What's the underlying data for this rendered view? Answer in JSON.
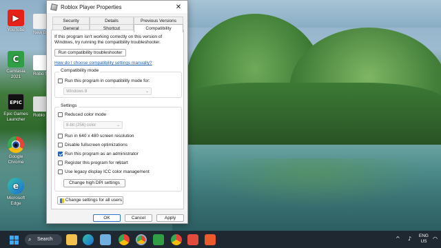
{
  "desktop": {
    "icons": [
      {
        "label": "YouTube",
        "color": "#e62117",
        "glyph": "▶"
      },
      {
        "label": "Camtasia 2021",
        "color": "#2f9e44",
        "glyph": "C"
      },
      {
        "label": "Epic Games Launcher",
        "color": "#111111",
        "glyph": "EPIC"
      },
      {
        "label": "Google Chrome",
        "color": "#e8eaed",
        "glyph": "◉"
      },
      {
        "label": "Microsoft Edge",
        "color": "#1b9de2",
        "glyph": "e"
      }
    ],
    "partial_icons": [
      {
        "label": "New Bene",
        "color": "#f0f0f0"
      },
      {
        "label": "Robo Stu",
        "color": "#ffffff"
      },
      {
        "label": "Roblo",
        "color": "#dddddd"
      }
    ]
  },
  "dialog": {
    "title": "Roblox Player Properties",
    "close_glyph": "✕",
    "tabs_row1": [
      "Security",
      "Details",
      "Previous Versions"
    ],
    "tabs_row2": [
      "General",
      "Shortcut",
      "Compatibility"
    ],
    "active_tab": "Compatibility",
    "intro_text": "If this program isn't working correctly on this version of Windows, try running the compatibility troubleshooter.",
    "troubleshooter_button": "Run compatibility troubleshooter",
    "manual_link": "How do I choose compatibility settings manually?",
    "compat_mode": {
      "group_label": "Compatibility mode",
      "checkbox_label": "Run this program in compatibility mode for:",
      "checked": false,
      "select_value": "Windows 8"
    },
    "settings": {
      "group_label": "Settings",
      "reduced_color": {
        "label": "Reduced color mode",
        "checked": false
      },
      "color_select": "8-bit (256) color",
      "options": [
        {
          "label": "Run in 640 x 480 screen resolution",
          "checked": false
        },
        {
          "label": "Disable fullscreen optimizations",
          "checked": false
        },
        {
          "label": "Run this program as an administrator",
          "checked": true
        },
        {
          "label": "Register this program for restart",
          "checked": false
        },
        {
          "label": "Use legacy display ICC color management",
          "checked": false
        }
      ],
      "dpi_button": "Change high DPI settings"
    },
    "all_users_button": "Change settings for all users",
    "footer": {
      "ok": "OK",
      "cancel": "Cancel",
      "apply": "Apply"
    }
  },
  "taskbar": {
    "search_label": "Search",
    "search_glyph": "⌕",
    "apps": [
      {
        "name": "file-explorer",
        "color": "#f2c14e"
      },
      {
        "name": "edge",
        "color": "#1b9de2"
      },
      {
        "name": "store",
        "color": "#6fb0e0"
      },
      {
        "name": "chrome",
        "color": "#e8eaed"
      },
      {
        "name": "chrome-alt",
        "color": "#d0d7e0"
      },
      {
        "name": "camtasia",
        "color": "#2f9e44"
      },
      {
        "name": "chrome-profile",
        "color": "#c8d4e0"
      },
      {
        "name": "app-red",
        "color": "#e24b3b"
      },
      {
        "name": "app-orange",
        "color": "#ea5a2c"
      }
    ],
    "tray": {
      "lang_top": "ENG",
      "lang_bottom": "US",
      "chevron": "^",
      "mic": "♪",
      "wifi": "◠",
      "volume": "◂)",
      "battery": "▭"
    }
  }
}
